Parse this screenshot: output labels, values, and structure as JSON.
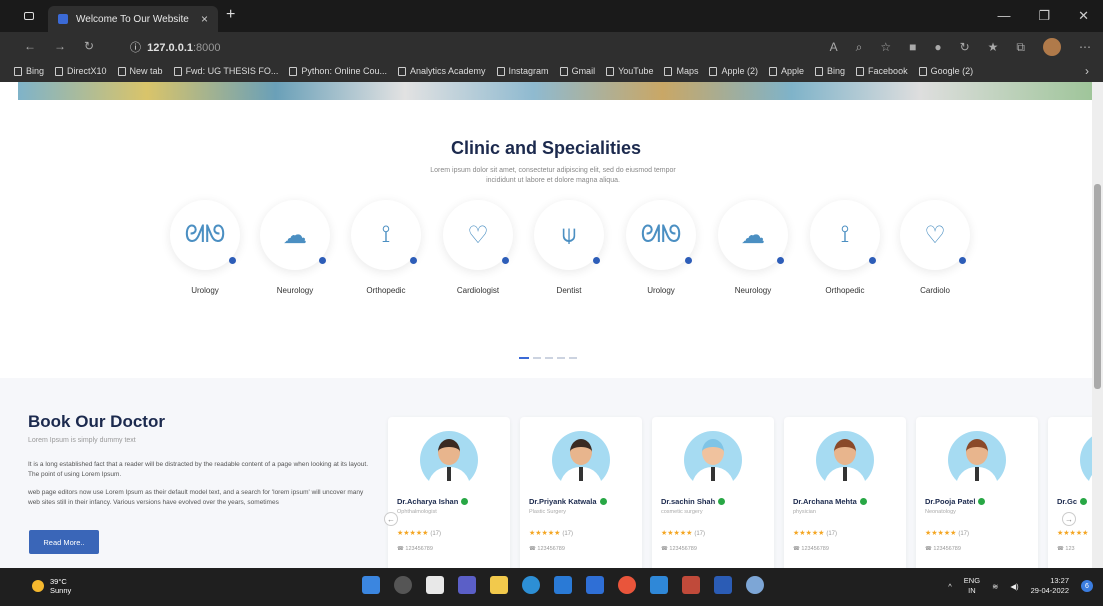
{
  "browser": {
    "tab_title": "Welcome To Our Website",
    "url_host": "127.0.0.1",
    "url_port": ":8000",
    "bookmarks": [
      "Bing",
      "DirectX10",
      "New tab",
      "Fwd: UG THESIS FO...",
      "Python: Online Cou...",
      "Analytics Academy",
      "Instagram",
      "Gmail",
      "YouTube",
      "Maps",
      "Apple (2)",
      "Apple",
      "Bing",
      "Facebook",
      "Google (2)"
    ]
  },
  "specialities": {
    "title": "Clinic and Specialities",
    "subtitle": "Lorem ipsum dolor sit amet, consectetur adipiscing elit, sed do eiusmod tempor incididunt ut labore et dolore magna aliqua.",
    "items": [
      {
        "label": "Urology",
        "icon": "kidneys-icon"
      },
      {
        "label": "Neurology",
        "icon": "brain-icon"
      },
      {
        "label": "Orthopedic",
        "icon": "bone-icon"
      },
      {
        "label": "Cardiologist",
        "icon": "heart-icon"
      },
      {
        "label": "Dentist",
        "icon": "tooth-icon"
      },
      {
        "label": "Urology",
        "icon": "kidneys-icon"
      },
      {
        "label": "Neurology",
        "icon": "brain-icon"
      },
      {
        "label": "Orthopedic",
        "icon": "bone-icon"
      },
      {
        "label": "Cardiolo",
        "icon": "heart-icon"
      }
    ]
  },
  "book": {
    "title": "Book Our Doctor",
    "lead": "Lorem Ipsum is simply dummy text",
    "para1": "It is a long established fact that a reader will be distracted by the readable content of a page when looking at its layout. The point of using Lorem Ipsum.",
    "para2": "web page editors now use Lorem Ipsum as their default model text, and a search for 'lorem ipsum' will uncover many web sites still in their infancy. Various versions have evolved over the years, sometimes",
    "read_more": "Read More..",
    "doctors": [
      {
        "name": "Dr.Acharya Ishan",
        "spec": "Ophthalmologist",
        "reviews": "(17)",
        "phone": "123456789",
        "skin": "#e8b58d",
        "hair": "#3a2a22",
        "bg": "#a6dbf2"
      },
      {
        "name": "Dr.Priyank Katwala",
        "spec": "Plastic Surgery",
        "reviews": "(17)",
        "phone": "123456789",
        "skin": "#e8b58d",
        "hair": "#3a2a22",
        "bg": "#a6dbf2"
      },
      {
        "name": "Dr.sachin Shah",
        "spec": "cosmetic surgery",
        "reviews": "(17)",
        "phone": "123456789",
        "skin": "#f0c29e",
        "hair": "#7fc4e6",
        "bg": "#a6dbf2"
      },
      {
        "name": "Dr.Archana Mehta",
        "spec": "physician",
        "reviews": "(17)",
        "phone": "123456789",
        "skin": "#e8b58d",
        "hair": "#8a4a2a",
        "bg": "#a6dbf2"
      },
      {
        "name": "Dr.Pooja Patel",
        "spec": "Neonatology",
        "reviews": "(17)",
        "phone": "123456789",
        "skin": "#e8b58d",
        "hair": "#8a4a2a",
        "bg": "#a6dbf2"
      },
      {
        "name": "Dr.Gc",
        "spec": "",
        "reviews": "",
        "phone": "123",
        "skin": "#e8b58d",
        "hair": "#3a2a22",
        "bg": "#a6dbf2"
      }
    ]
  },
  "taskbar": {
    "temp": "39°C",
    "condition": "Sunny",
    "lang": "ENG",
    "region": "IN",
    "time": "13:27",
    "date": "29-04-2022",
    "notifications": "6"
  },
  "colors": {
    "accent": "#3a66b8",
    "heading": "#1c2a4e",
    "verified": "#28a745",
    "star": "#f4a623"
  }
}
